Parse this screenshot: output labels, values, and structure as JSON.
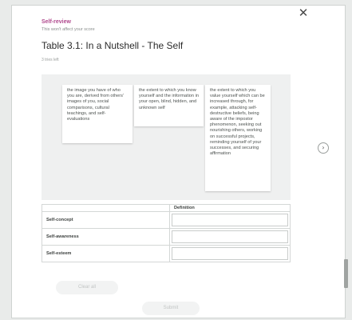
{
  "header": {
    "section_label": "Self-review",
    "note": "This won't affect your score",
    "title": "Table 3.1: In a Nutshell - The Self",
    "tries": "3 tries left"
  },
  "icons": {
    "close": "close-icon",
    "next": "chevron-right-icon"
  },
  "bank": {
    "items": [
      {
        "text": "the image you have of who you are, derived from others' images of you, social comparisons, cultural teachings, and self-evaluations"
      },
      {
        "text": "the extent to which you know yourself and the information in your open, blind, hidden, and unknown self"
      },
      {
        "text": "the extent to which you value yourself which can be increased through, for example, attacking self-destructive beliefs, being aware of the impostor phenomenon, seeking out nourishing others, working on successful projects, reminding yourself of your successes, and securing affirmation"
      }
    ]
  },
  "table": {
    "columns": [
      "",
      "Definition"
    ],
    "rows": [
      {
        "label": "Self-concept"
      },
      {
        "label": "Self-awareness"
      },
      {
        "label": "Self-esteem"
      }
    ]
  },
  "buttons": {
    "clear_all": "Clear all",
    "submit": "Submit"
  },
  "colors": {
    "accent": "#b04a8e",
    "background": "#e9ebea",
    "bank_background": "#eff0f0"
  }
}
